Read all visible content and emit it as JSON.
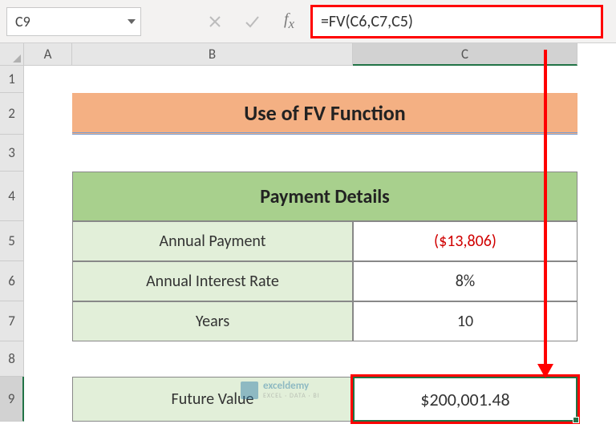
{
  "nameBox": "C9",
  "formula": "=FV(C6,C7,C5)",
  "columns": {
    "A": "A",
    "B": "B",
    "C": "C"
  },
  "rows": [
    "1",
    "2",
    "3",
    "4",
    "5",
    "6",
    "7",
    "8",
    "9"
  ],
  "title": "Use of FV Function",
  "table": {
    "header": "Payment Details",
    "rows": [
      {
        "label": "Annual Payment",
        "value": "($13,806)",
        "neg": true
      },
      {
        "label": "Annual Interest Rate",
        "value": "8%"
      },
      {
        "label": "Years",
        "value": "10"
      }
    ]
  },
  "result": {
    "label": "Future Value",
    "value": "$200,001.48"
  },
  "watermark": {
    "name": "exceldemy",
    "sub": "EXCEL · DATA · BI"
  }
}
